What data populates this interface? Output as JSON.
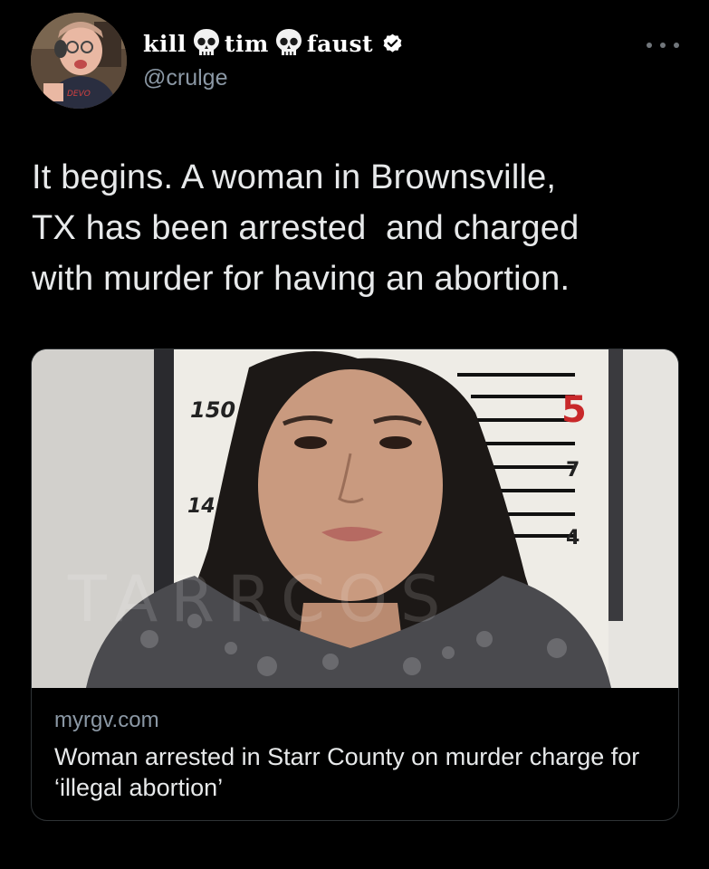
{
  "author": {
    "name_parts": [
      "kill",
      "tim",
      "faust"
    ],
    "name_emoji": "skull-emoji",
    "handle": "@crulge",
    "verified": true,
    "avatar_shirt_text": "DEVO"
  },
  "tweet": {
    "text": "It begins. A woman in Brownsville,\nTX has been arrested  and charged\nwith murder for having an abortion."
  },
  "card": {
    "domain": "myrgv.com",
    "title": "Woman arrested in Starr County on murder charge for ‘illegal abortion’",
    "image": {
      "board_numbers": [
        "150",
        "14",
        "5",
        "7",
        "4"
      ],
      "watermark": "TARRCOS"
    }
  },
  "colors": {
    "background": "#000000",
    "text": "#e7e9ea",
    "secondary_text": "#8b98a5",
    "verified_badge": "#ffffff",
    "card_border": "#2f3336",
    "board_red": "#c8282a"
  },
  "icons": {
    "more": "more-horizontal-icon",
    "verified": "verified-badge-icon"
  }
}
